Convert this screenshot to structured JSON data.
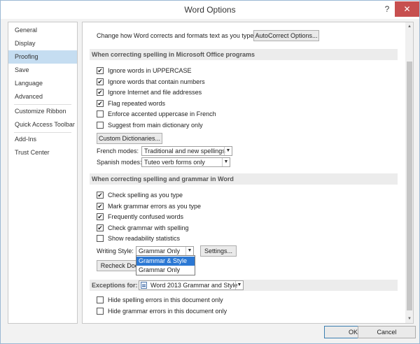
{
  "window": {
    "title": "Word Options",
    "help": "?",
    "close": "✕"
  },
  "sidebar": {
    "items": [
      {
        "label": "General"
      },
      {
        "label": "Display"
      },
      {
        "label": "Proofing"
      },
      {
        "label": "Save"
      },
      {
        "label": "Language"
      },
      {
        "label": "Advanced"
      },
      {
        "label": "Customize Ribbon"
      },
      {
        "label": "Quick Access Toolbar"
      },
      {
        "label": "Add-Ins"
      },
      {
        "label": "Trust Center"
      }
    ]
  },
  "autocorrect": {
    "label": "Change how Word corrects and formats text as you type:",
    "button": "AutoCorrect Options..."
  },
  "office_section": {
    "heading": "When correcting spelling in Microsoft Office programs",
    "options": [
      {
        "label": "Ignore words in UPPERCASE",
        "checked": true
      },
      {
        "label": "Ignore words that contain numbers",
        "checked": true
      },
      {
        "label": "Ignore Internet and file addresses",
        "checked": true
      },
      {
        "label": "Flag repeated words",
        "checked": true
      },
      {
        "label": "Enforce accented uppercase in French",
        "checked": false
      },
      {
        "label": "Suggest from main dictionary only",
        "checked": false
      }
    ],
    "custom_dict_button": "Custom Dictionaries...",
    "french_label": "French modes:",
    "french_value": "Traditional and new spellings",
    "spanish_label": "Spanish modes:",
    "spanish_value": "Tuteo verb forms only"
  },
  "word_section": {
    "heading": "When correcting spelling and grammar in Word",
    "options": [
      {
        "label": "Check spelling as you type",
        "checked": true
      },
      {
        "label": "Mark grammar errors as you type",
        "checked": true
      },
      {
        "label": "Frequently confused words",
        "checked": true
      },
      {
        "label": "Check grammar with spelling",
        "checked": true
      },
      {
        "label": "Show readability statistics",
        "checked": false
      }
    ],
    "writing_style_label": "Writing Style:",
    "writing_style_value": "Grammar Only",
    "settings_button": "Settings...",
    "recheck_button": "Recheck Document",
    "style_options": [
      "Grammar & Style",
      "Grammar Only"
    ]
  },
  "exceptions": {
    "label": "Exceptions for:",
    "document": "Word 2013 Grammar and Style",
    "options": [
      {
        "label": "Hide spelling errors in this document only",
        "checked": false
      },
      {
        "label": "Hide grammar errors in this document only",
        "checked": false
      }
    ]
  },
  "footer": {
    "ok": "OK",
    "cancel": "Cancel"
  },
  "glyphs": {
    "check": "✔",
    "arrow": "▼",
    "up": "▲",
    "down": "▼"
  }
}
